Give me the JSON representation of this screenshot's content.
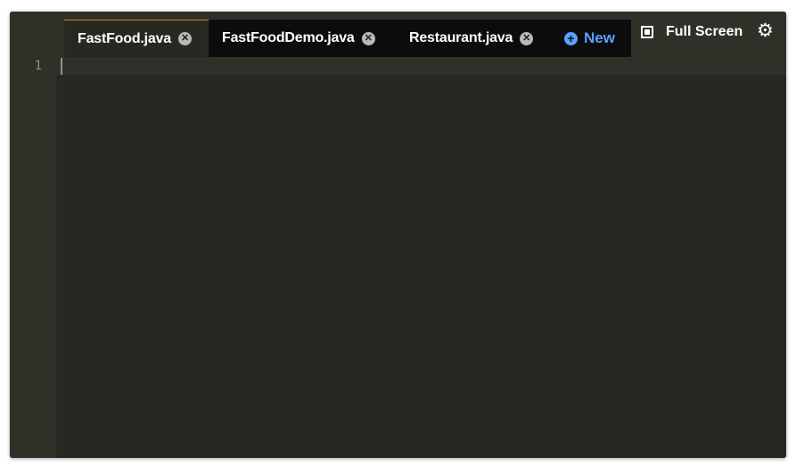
{
  "tabs": [
    {
      "label": "FastFood.java",
      "active": true,
      "close_icon": "close-circle-icon"
    },
    {
      "label": "FastFoodDemo.java",
      "active": false,
      "close_icon": "close-circle-icon"
    },
    {
      "label": "Restaurant.java",
      "active": false,
      "close_icon": "close-circle-icon"
    }
  ],
  "new_tab": {
    "label": "New",
    "icon": "plus-circle-icon"
  },
  "toolbar": {
    "fullscreen_label": "Full Screen",
    "fullscreen_icon": "fullscreen-icon",
    "settings_icon": "gear-icon"
  },
  "editor": {
    "line_numbers": [
      "1"
    ],
    "content": ""
  },
  "colors": {
    "background": "#272822",
    "gutter": "#2f3129",
    "tab_bar": "#0c0c0c",
    "active_tab_accent": "#e0771f",
    "new_link": "#5aa0ff"
  }
}
